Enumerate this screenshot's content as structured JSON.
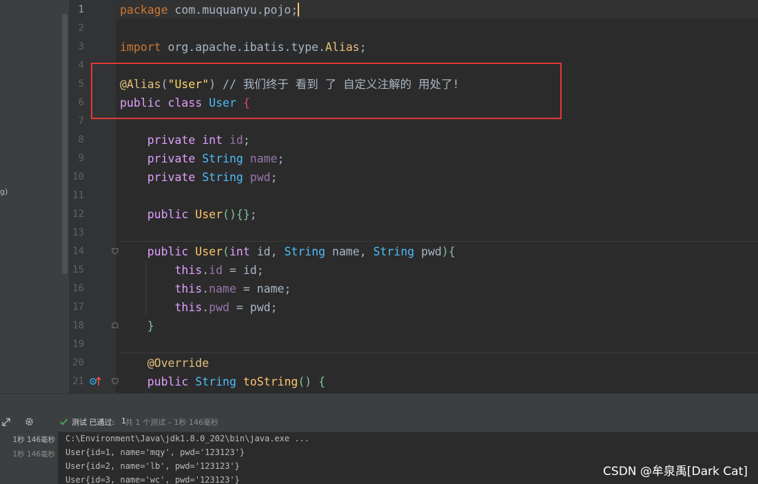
{
  "sidebar": {
    "truncated_text": "g)"
  },
  "editor": {
    "line_numbers": [
      "1",
      "2",
      "3",
      "4",
      "5",
      "6",
      "7",
      "8",
      "9",
      "10",
      "11",
      "12",
      "13",
      "14",
      "15",
      "16",
      "17",
      "18",
      "19",
      "20",
      "21"
    ],
    "l1": {
      "kw": "package",
      "pkg": "com.muquanyu.pojo",
      "semi": ";"
    },
    "l3": {
      "kw": "import",
      "pkg": "org.apache.ibatis.type.",
      "cls": "Alias",
      "semi": ";"
    },
    "l5": {
      "ann": "@Alias",
      "p1": "(",
      "str": "\"User\"",
      "p2": ")",
      "cmt": " // 我们终于 看到 了 自定义注解的 用处了!"
    },
    "l6": {
      "kw1": "public",
      "kw2": "class",
      "cls": "User",
      "brace": "{"
    },
    "l8": {
      "kw": "private",
      "type": "int",
      "name": "id",
      "semi": ";"
    },
    "l9": {
      "kw": "private",
      "type": "String",
      "name": "name",
      "semi": ";"
    },
    "l10": {
      "kw": "private",
      "type": "String",
      "name": "pwd",
      "semi": ";"
    },
    "l12": {
      "kw": "public",
      "fn": "User",
      "rest": "(){}",
      "semi": ";"
    },
    "l14": {
      "kw": "public",
      "fn": "User",
      "p1": "(",
      "t1": "int",
      "a1": " id, ",
      "t2": "String",
      "a2": " name, ",
      "t3": "String",
      "a3": " pwd",
      "p2": "){"
    },
    "l15": {
      "kw": "this",
      "dot": ".",
      "fld": "id",
      "rest": " = id",
      "semi": ";"
    },
    "l16": {
      "kw": "this",
      "dot": ".",
      "fld": "name",
      "rest": " = name",
      "semi": ";"
    },
    "l17": {
      "kw": "this",
      "dot": ".",
      "fld": "pwd",
      "rest": " = pwd",
      "semi": ";"
    },
    "l18": {
      "brace": "}"
    },
    "l20": {
      "ann": "@Override"
    },
    "l21": {
      "kw": "public",
      "type": "String",
      "fn": "toString",
      "rest": "() ",
      "brace": "{"
    }
  },
  "run_panel": {
    "status_label": "测试 已通过:",
    "passed_count": "1",
    "summary": "共 1 个测试 – 1秒 146毫秒",
    "tree_times": [
      "1秒 146毫秒",
      "1秒 146毫秒"
    ],
    "console_lines": [
      "C:\\Environment\\Java\\jdk1.8.0_202\\bin\\java.exe ...",
      "User{id=1, name='mqy', pwd='123123'}",
      "User{id=2, name='lb', pwd='123123'}",
      "User{id=3, name='wc', pwd='123123'}"
    ]
  },
  "watermark": "CSDN @牟泉禹[Dark Cat]",
  "colors": {
    "highlight_box": "#e53935",
    "keyword": "#cc7832",
    "class": "#4ebdfa",
    "annotation": "#e5c07b",
    "pass_check": "#499c54"
  }
}
